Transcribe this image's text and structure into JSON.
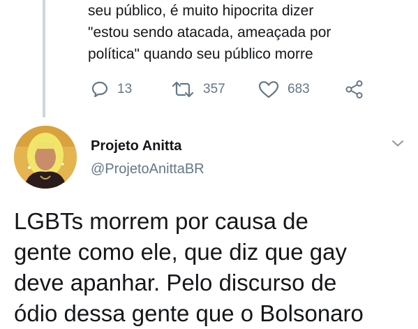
{
  "previous_tweet": {
    "lines": [
      "seu público, é muito hipocrita dizer",
      "\"estou sendo atacada, ameaçada por",
      "política\" quando seu público morre"
    ],
    "replies": "13",
    "retweets": "357",
    "likes": "683"
  },
  "tweet": {
    "display_name": "Projeto Anitta",
    "handle": "@ProjetoAnittaBR",
    "lines": [
      "LGBTs morrem por causa de",
      "gente como ele, que diz que gay",
      "deve apanhar. Pelo discurso de",
      "ódio dessa gente que o Bolsonaro"
    ]
  },
  "colors": {
    "text": "#14171a",
    "secondary": "#657786",
    "thread_line": "#ccd6dd"
  },
  "icons": [
    "reply-icon",
    "retweet-icon",
    "like-icon",
    "share-icon",
    "chevron-down-icon"
  ]
}
